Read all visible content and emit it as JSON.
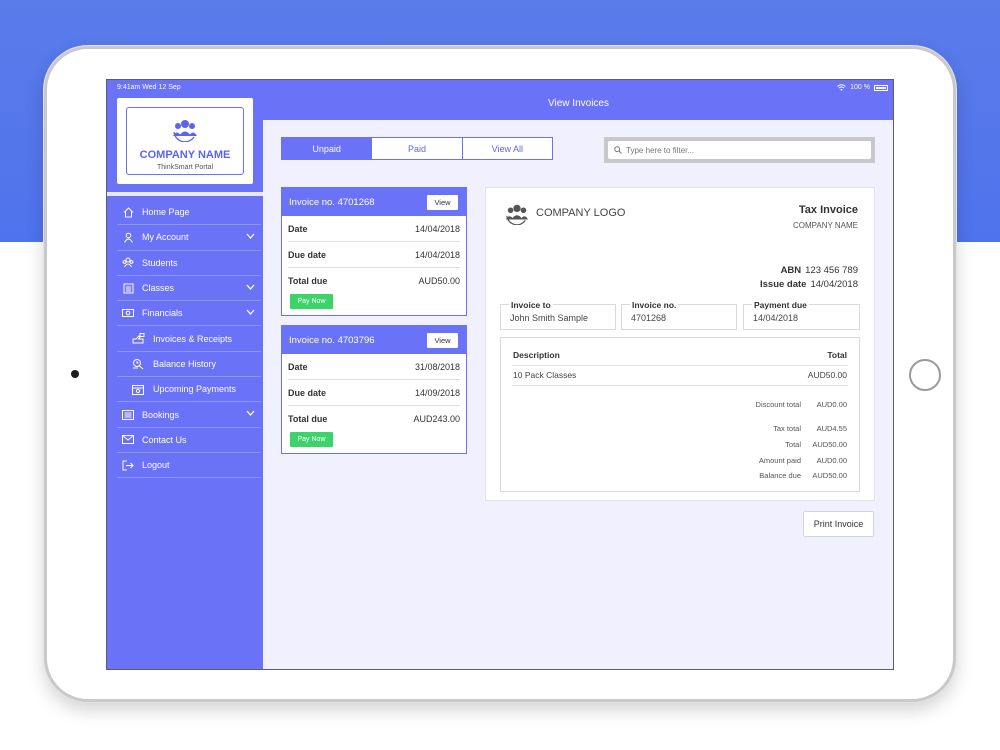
{
  "status": {
    "time_date": "9:41am   Wed 12 Sep",
    "battery": "100 %"
  },
  "sidebar": {
    "company_name": "COMPANY NAME",
    "portal_name": "ThinkSmart Portal",
    "items": [
      {
        "label": "Home Page",
        "icon": "home-icon"
      },
      {
        "label": "My Account",
        "icon": "user-icon"
      },
      {
        "label": "Students",
        "icon": "students-icon"
      },
      {
        "label": "Classes",
        "icon": "classes-icon"
      },
      {
        "label": "Financials",
        "icon": "money-icon"
      },
      {
        "label": "Invoices & Receipts",
        "icon": "hand-icon"
      },
      {
        "label": "Balance History",
        "icon": "history-icon"
      },
      {
        "label": "Upcoming Payments",
        "icon": "calendar-icon"
      },
      {
        "label": "Bookings",
        "icon": "bookings-icon"
      },
      {
        "label": "Contact Us",
        "icon": "mail-icon"
      },
      {
        "label": "Logout",
        "icon": "logout-icon"
      }
    ]
  },
  "header": {
    "title": "View Invoices"
  },
  "tabs": [
    {
      "label": "Unpaid"
    },
    {
      "label": "Paid"
    },
    {
      "label": "View All"
    }
  ],
  "filter": {
    "placeholder": "Type here to filter..."
  },
  "invoices": [
    {
      "title": "Invoice no. 4701268",
      "view": "View",
      "date_label": "Date",
      "date": "14/04/2018",
      "due_label": "Due date",
      "due": "14/04/2018",
      "total_label": "Total due",
      "total": "AUD50.00",
      "pay": "Pay Now"
    },
    {
      "title": "Invoice no. 4703796",
      "view": "View",
      "date_label": "Date",
      "date": "31/08/2018",
      "due_label": "Due date",
      "due": "14/09/2018",
      "total_label": "Total due",
      "total": "AUD243.00",
      "pay": "Pay Now"
    }
  ],
  "tax_invoice": {
    "logo_text": "COMPANY LOGO",
    "title": "Tax Invoice",
    "company": "COMPANY NAME",
    "abn_label": "ABN",
    "abn": "123 456 789",
    "issue_label": "Issue date",
    "issue_date": "14/04/2018",
    "fields": [
      {
        "label": "Invoice to",
        "value": "John Smith Sample"
      },
      {
        "label": "Invoice no.",
        "value": "4701268"
      },
      {
        "label": "Payment due",
        "value": "14/04/2018"
      }
    ],
    "col_description": "Description",
    "col_total": "Total",
    "line": {
      "description": "10 Pack Classes",
      "total": "AUD50.00"
    },
    "totals": [
      {
        "label": "Discount total",
        "value": "AUD0.00"
      },
      {
        "label": "Tax total",
        "value": "AUD4.55"
      },
      {
        "label": "Total",
        "value": "AUD50.00"
      },
      {
        "label": "Amount paid",
        "value": "AUD0.00"
      },
      {
        "label": "Balance due",
        "value": "AUD50.00"
      }
    ]
  },
  "print_label": "Print Invoice",
  "colors": {
    "accent": "#6a72f7",
    "pay": "#3cd36b",
    "background_blue": "#4f73ec"
  }
}
